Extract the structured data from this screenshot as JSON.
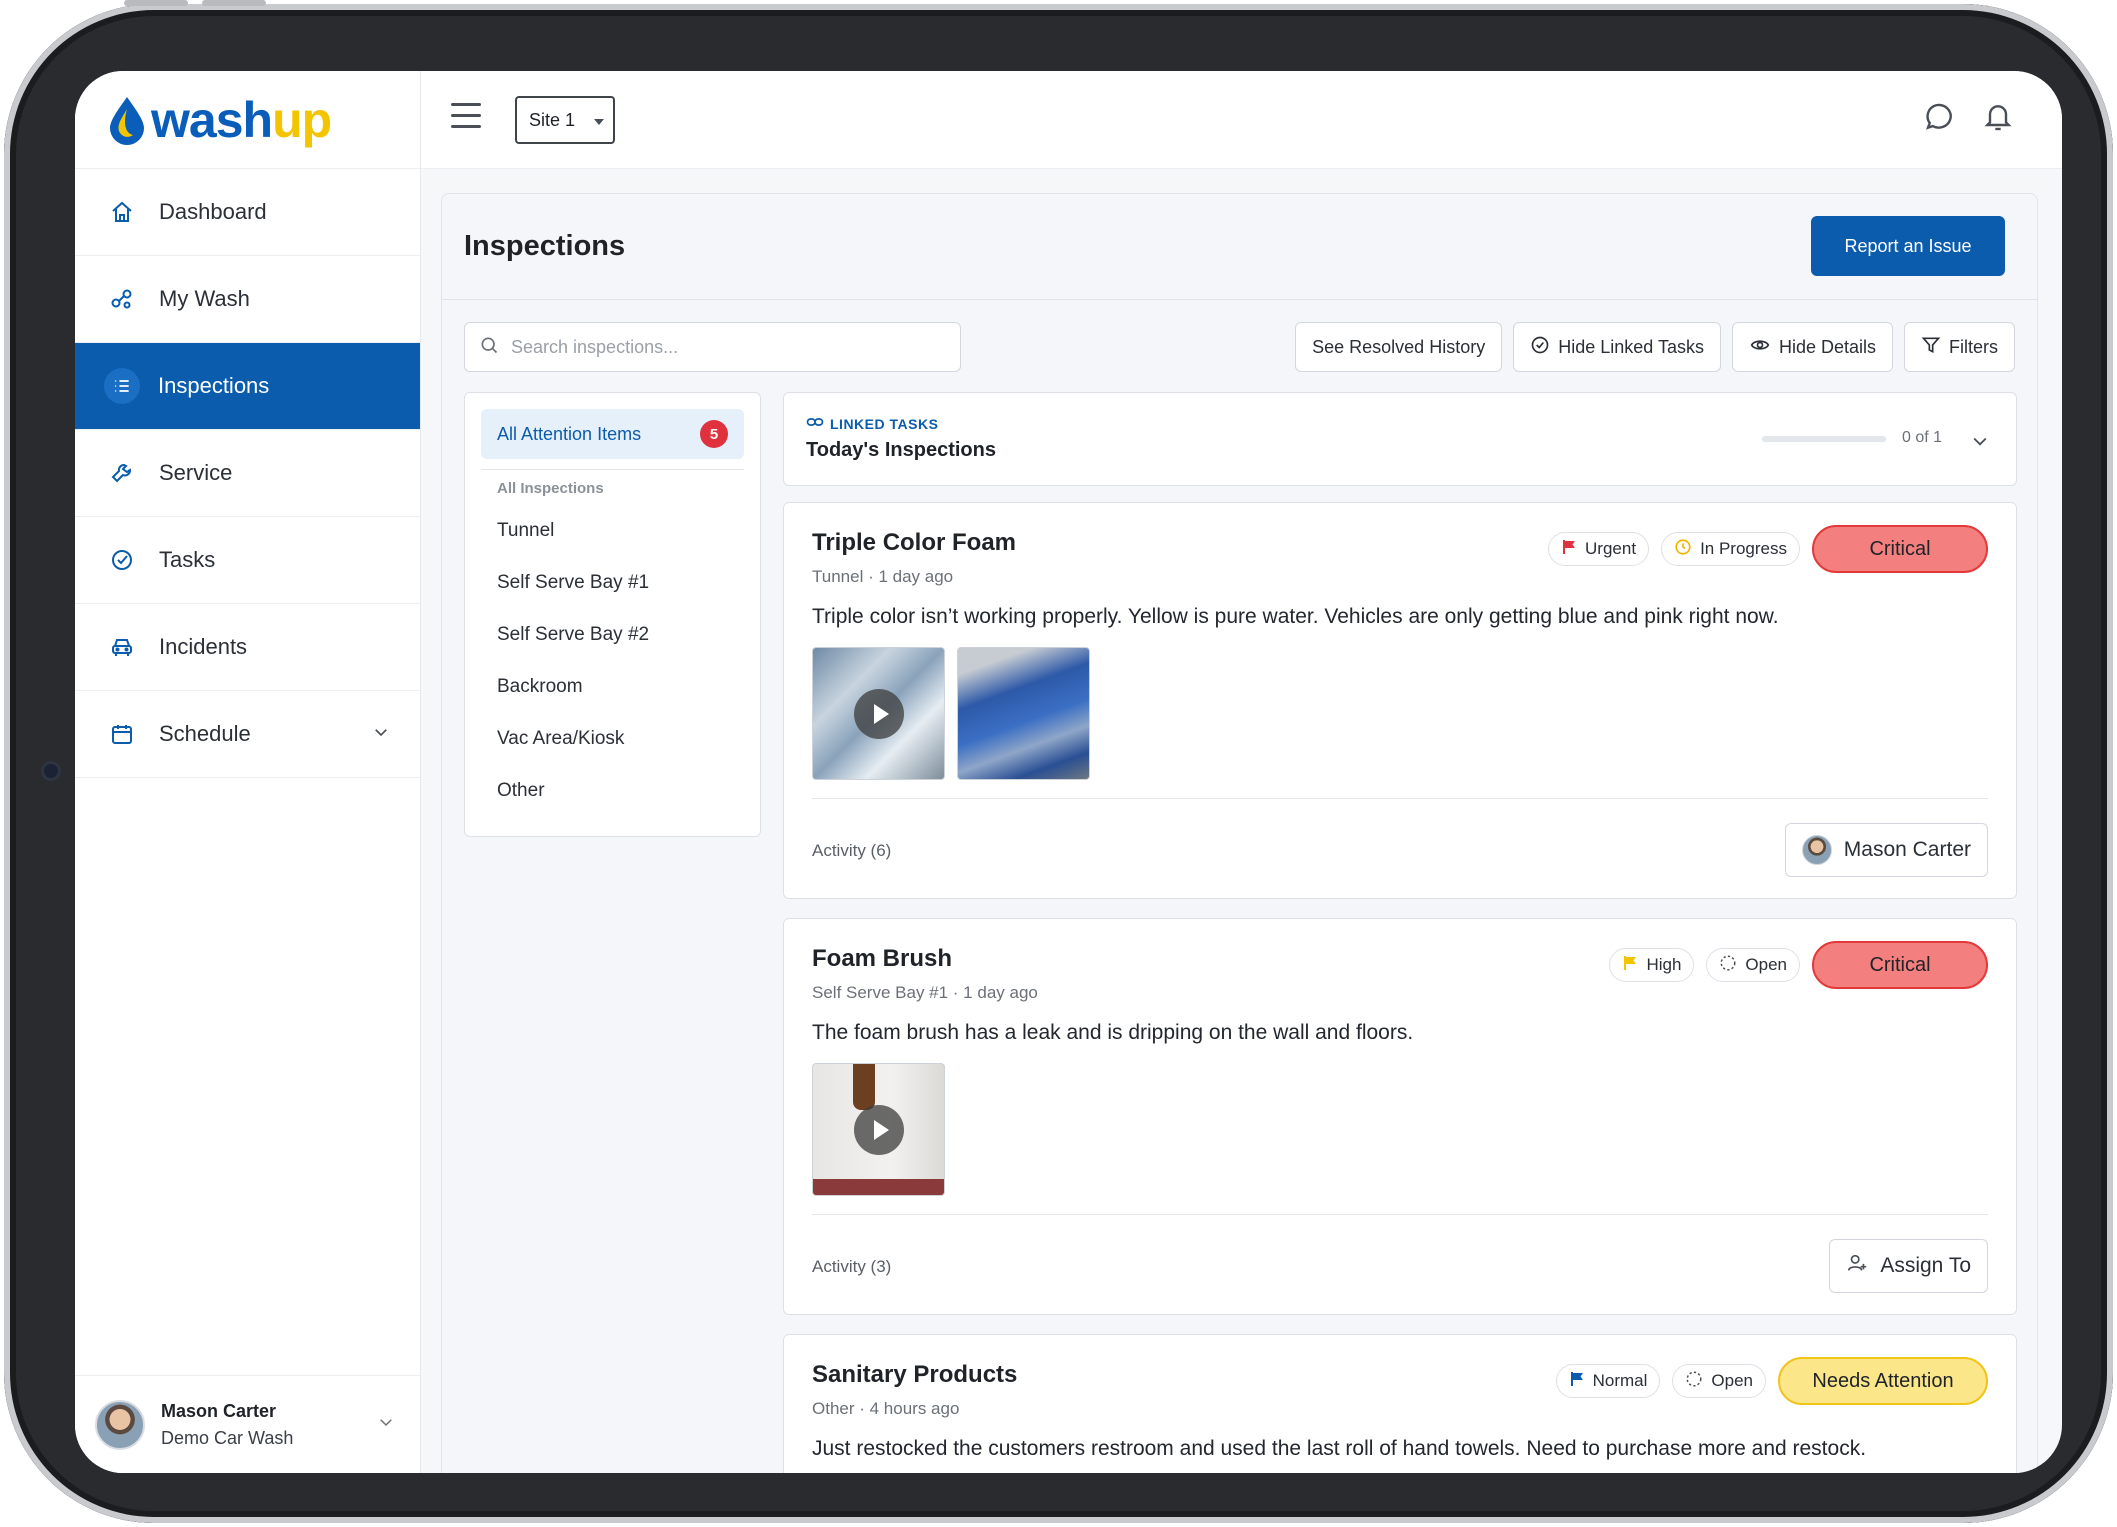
{
  "app": {
    "logo_part1": "wash",
    "logo_part2": "up"
  },
  "sidebar": {
    "items": [
      {
        "label": "Dashboard",
        "icon": "home-icon"
      },
      {
        "label": "My Wash",
        "icon": "nodes-icon"
      },
      {
        "label": "Inspections",
        "icon": "list-icon",
        "active": true
      },
      {
        "label": "Service",
        "icon": "wrench-icon"
      },
      {
        "label": "Tasks",
        "icon": "check-circle-icon"
      },
      {
        "label": "Incidents",
        "icon": "car-icon"
      },
      {
        "label": "Schedule",
        "icon": "calendar-icon",
        "expandable": true
      }
    ],
    "user": {
      "name": "Mason Carter",
      "org": "Demo Car Wash"
    }
  },
  "topbar": {
    "site_select": "Site 1",
    "icons": [
      "chat-icon",
      "bell-icon"
    ]
  },
  "page": {
    "title": "Inspections",
    "report_button": "Report an Issue",
    "search_placeholder": "Search inspections...",
    "toolbar": {
      "resolved": "See Resolved History",
      "hide_linked": "Hide Linked Tasks",
      "hide_details": "Hide Details",
      "filters": "Filters"
    }
  },
  "categories": {
    "all_label": "All Attention Items",
    "all_count": "5",
    "heading": "All Inspections",
    "items": [
      "Tunnel",
      "Self Serve Bay #1",
      "Self Serve Bay #2",
      "Backroom",
      "Vac Area/Kiosk",
      "Other"
    ]
  },
  "linked_tasks": {
    "tag": "LINKED TASKS",
    "title": "Today's Inspections",
    "progress_label": "0 of 1",
    "progress_fraction": 0
  },
  "cards": [
    {
      "title": "Triple Color Foam",
      "meta": "Tunnel · 1 day ago",
      "description": "Triple color isn’t working properly. Yellow is pure water. Vehicles are only getting blue and pink right now.",
      "priority": "Urgent",
      "status": "In Progress",
      "severity": "Critical",
      "activity": "Activity (6)",
      "assignee": "Mason Carter"
    },
    {
      "title": "Foam Brush",
      "meta": "Self Serve Bay #1 · 1 day ago",
      "description": "The foam brush has a leak and is dripping on the wall and floors.",
      "priority": "High",
      "status": "Open",
      "severity": "Critical",
      "activity": "Activity (3)",
      "assign_label": "Assign To"
    },
    {
      "title": "Sanitary Products",
      "meta": "Other · 4 hours ago",
      "description": "Just restocked the customers restroom and used the last roll of hand towels. Need to purchase more and restock.",
      "priority": "Normal",
      "status": "Open",
      "severity": "Needs Attention"
    }
  ],
  "colors": {
    "brand_blue": "#0b5cad",
    "brand_yellow": "#f2c500",
    "critical": "#f3807f",
    "attention": "#fbe68a",
    "urgent_flag": "#e0313e",
    "high_flag": "#f2c500",
    "normal_flag": "#0b5cad"
  }
}
